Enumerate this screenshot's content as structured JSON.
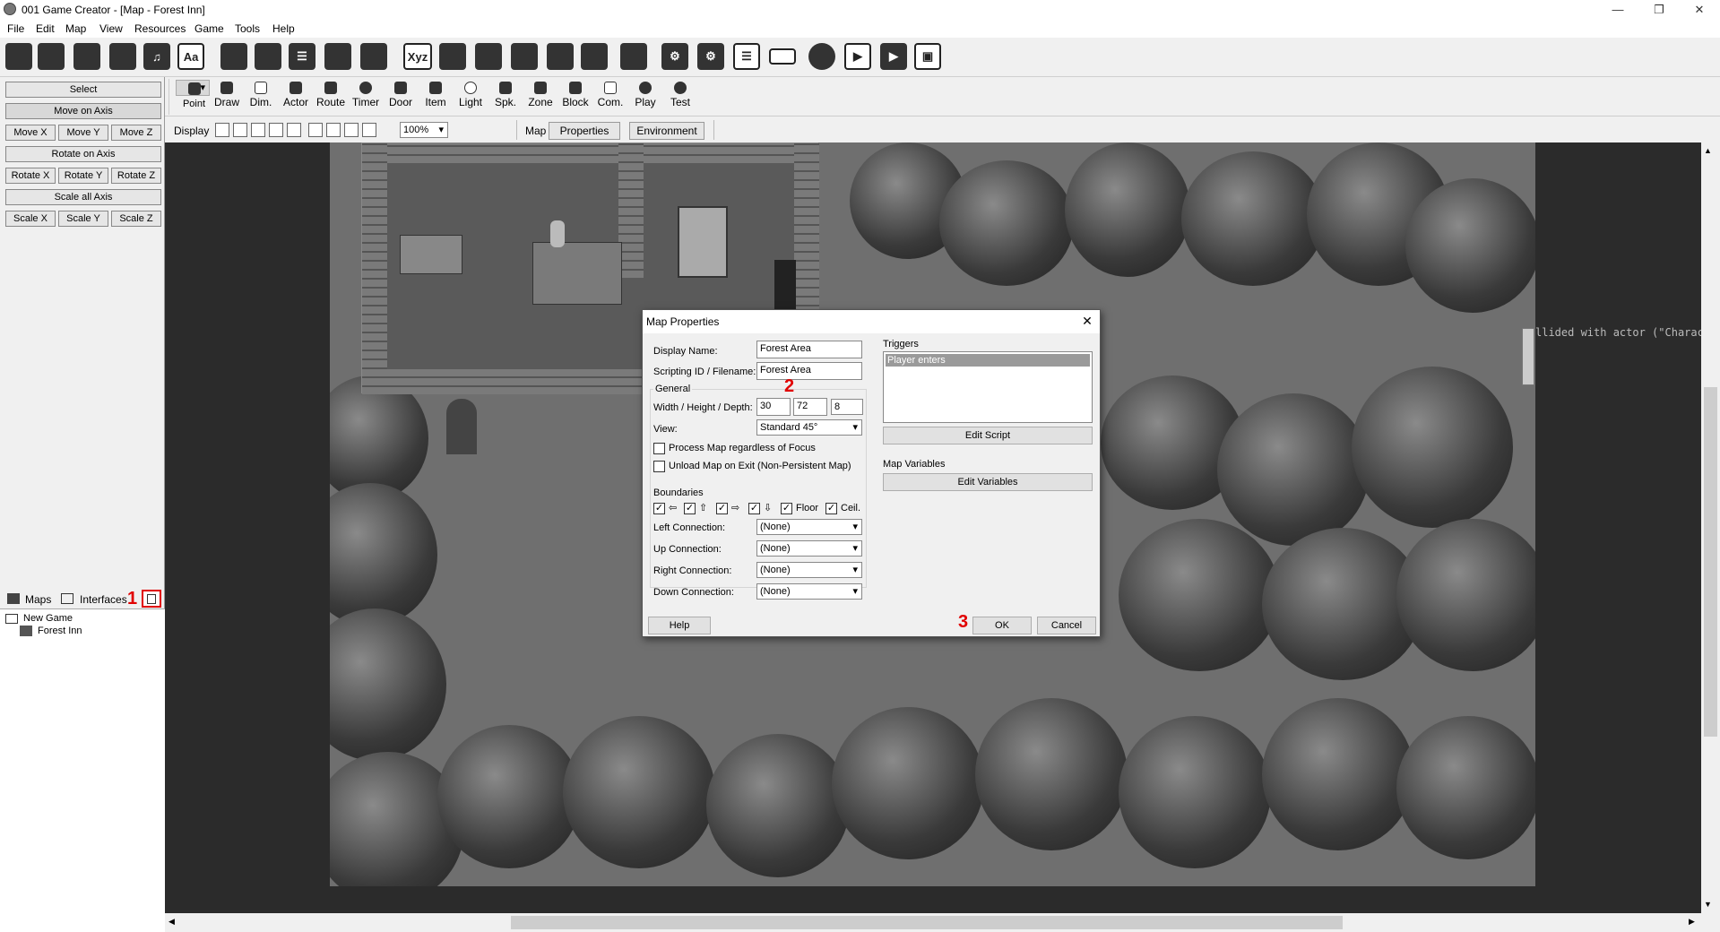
{
  "window": {
    "title": "001 Game Creator - [Map - Forest Inn]",
    "minimize": "—",
    "maximize": "❐",
    "close": "✕"
  },
  "menu": [
    "File",
    "Edit",
    "Map",
    "View",
    "Resources",
    "Game",
    "Tools",
    "Help"
  ],
  "toolbar_icons": [
    "actor-icon",
    "player-icon",
    "door-icon",
    "item-bag-icon",
    "music-icon",
    "font-icon",
    "party-icon",
    "character-icon",
    "list-icon",
    "crowd-icon",
    "group-icon",
    "xyz-icon",
    "window-icon",
    "document-icon",
    "gamepad-icon",
    "drive-icon",
    "database-icon",
    "notes-icon",
    "gear-icon",
    "gears-icon",
    "text-list-icon",
    "textbox-icon",
    "globe-icon",
    "play-video-icon",
    "film-icon",
    "save-icon"
  ],
  "toolbar_text": {
    "xyz": "Xyz",
    "font": "Aa"
  },
  "left_panel": {
    "select": "Select",
    "move_axis": "Move on Axis",
    "move": [
      "Move X",
      "Move Y",
      "Move Z"
    ],
    "rotate_axis": "Rotate on Axis",
    "rotate": [
      "Rotate X",
      "Rotate Y",
      "Rotate Z"
    ],
    "scale_all": "Scale all Axis",
    "scale": [
      "Scale X",
      "Scale Y",
      "Scale Z"
    ]
  },
  "tools": [
    "Point",
    "Draw",
    "Dim.",
    "Actor",
    "Route",
    "Timer",
    "Door",
    "Item",
    "Light",
    "Spk.",
    "Zone",
    "Block",
    "Com.",
    "Play",
    "Test"
  ],
  "display_row": {
    "label": "Display",
    "zoom": "100%",
    "map_label": "Map",
    "properties": "Properties",
    "environment": "Environment"
  },
  "tabs": {
    "maps": "Maps",
    "interfaces": "Interfaces",
    "annotation_1": "1"
  },
  "tree": {
    "root": "New Game",
    "child": "Forest Inn"
  },
  "console": "llided with actor (\"Character",
  "dialog": {
    "title": "Map Properties",
    "display_name_label": "Display Name:",
    "display_name": "Forest Area",
    "scripting_label": "Scripting ID / Filename:",
    "scripting": "Forest Area",
    "general": "General",
    "annotation_2": "2",
    "whd_label": "Width / Height / Depth:",
    "width": "30",
    "height": "72",
    "depth": "8",
    "view_label": "View:",
    "view": "Standard 45°",
    "process_focus": "Process Map regardless of Focus",
    "unload": "Unload Map on Exit (Non-Persistent Map)",
    "boundaries": "Boundaries",
    "floor": "Floor",
    "ceil": "Ceil.",
    "left_conn_label": "Left Connection:",
    "up_conn_label": "Up Connection:",
    "right_conn_label": "Right Connection:",
    "down_conn_label": "Down Connection:",
    "none": "(None)",
    "triggers": "Triggers",
    "trigger_item": "Player enters",
    "edit_script": "Edit Script",
    "map_variables": "Map Variables",
    "edit_variables": "Edit Variables",
    "help": "Help",
    "annotation_3": "3",
    "ok": "OK",
    "cancel": "Cancel"
  }
}
